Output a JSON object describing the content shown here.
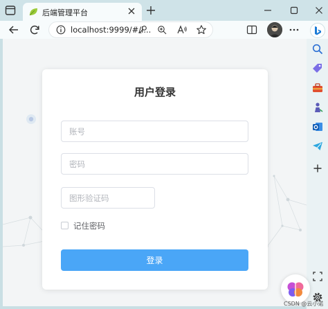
{
  "browser": {
    "tab_title": "后端管理平台",
    "url": "localhost:9999/#/l...",
    "accent": "#0f6cbd"
  },
  "icons": {
    "tab_actions": "tab-actions-icon",
    "favicon": "leaf-icon",
    "tab_close": "close-icon",
    "new_tab": "plus-icon",
    "back": "arrow-left-icon",
    "refresh": "refresh-icon",
    "info": "info-icon",
    "password_key": "key-icon",
    "zoom": "zoom-icon",
    "read_aloud": "read-aloud-icon",
    "favorite": "star-icon",
    "split": "split-screen-icon",
    "more": "more-icon",
    "copilot": "copilot-icon",
    "sidebar": [
      "search-icon",
      "tag-icon",
      "toolbox-icon",
      "chess-icon",
      "outlook-icon",
      "telegram-icon",
      "add-icon"
    ],
    "settings": "gear-icon",
    "screenshot": "screenshot-icon"
  },
  "login": {
    "title": "用户登录",
    "username_placeholder": "账号",
    "password_placeholder": "密码",
    "captcha_placeholder": "图形验证码",
    "remember_label": "记住密码",
    "submit_label": "登录",
    "button_color": "#4aa6f7"
  },
  "watermark": "CSDN @云小诺"
}
